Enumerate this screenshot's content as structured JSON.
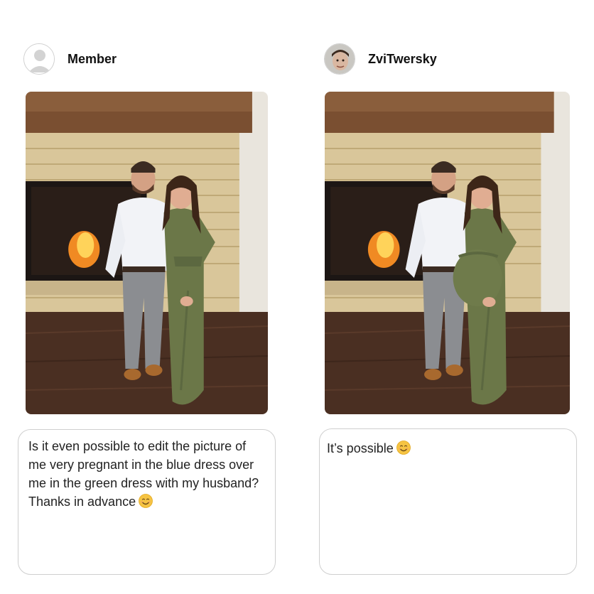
{
  "left_post": {
    "username": "Member",
    "avatar_icon": "default-user-icon",
    "photo": {
      "description_icon": "couple-photo-original",
      "dress_color": "#6b7748"
    },
    "message": "Is it even possible to edit the picture of me very pregnant in the blue dress over me in the green dress with my husband? Thanks in advance",
    "emoji": "smiling-face-emoji"
  },
  "right_post": {
    "username": "ZviTwersky",
    "avatar_icon": "profile-photo-avatar",
    "photo": {
      "description_icon": "couple-photo-edited",
      "dress_color": "#6b7748"
    },
    "message": "It’s possible",
    "emoji": "smiling-face-emoji"
  },
  "colors": {
    "border": "#cfcfcf",
    "emoji_yellow": "#f6c443"
  }
}
